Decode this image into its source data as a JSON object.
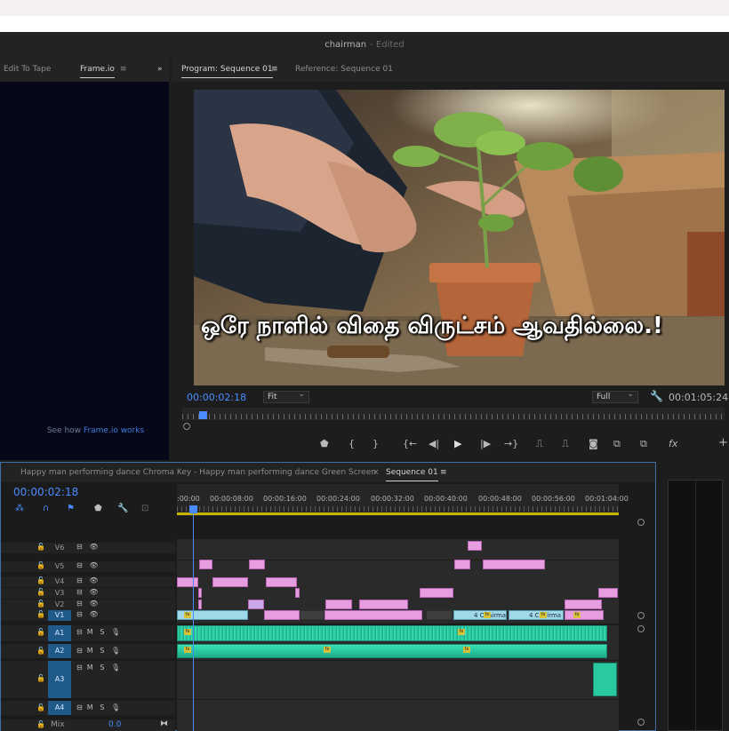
{
  "window": {
    "title": "chairman",
    "status": "- Edited"
  },
  "left_panel": {
    "tabs": [
      {
        "label": "Edit To Tape"
      },
      {
        "label": "Frame.io"
      }
    ],
    "menu_glyph": "≡",
    "overflow_glyph": "»",
    "footer_prefix": "See how ",
    "footer_link": "Frame.io works"
  },
  "program_monitor": {
    "tabs": [
      {
        "label": "Program: Sequence 01"
      },
      {
        "label": "Reference: Sequence 01"
      }
    ],
    "subtitle": "ஒரே நாளில் விதை விருட்சம் ஆவதில்லை.!",
    "timecode": "00:00:02:18",
    "fit_value": "Fit",
    "resolution_value": "Full",
    "duration": "00:01:05:24",
    "controls": [
      "marker-icon",
      "mark-in-icon",
      "mark-out-icon",
      "go-to-in-icon",
      "step-back-icon",
      "play-icon",
      "step-forward-icon",
      "go-to-out-icon",
      "lift-icon",
      "extract-icon",
      "export-frame-icon",
      "insert-icon",
      "overwrite-icon",
      "fx-icon",
      "add-icon"
    ]
  },
  "timeline": {
    "tabs": [
      {
        "label": "Happy man performing dance Chroma Key - Happy man performing dance Green Screen"
      },
      {
        "label": "Sequence 01"
      }
    ],
    "close_glyph": "×",
    "timecode": "00:00:02:18",
    "ruler_labels": [
      ":00:00",
      "00:00:08:00",
      "00:00:16:00",
      "00:00:24:00",
      "00:00:32:00",
      "00:00:40:00",
      "00:00:48:00",
      "00:00:56:00",
      "00:01:04:00"
    ],
    "video_tracks": [
      "V6",
      "V5",
      "V4",
      "V3",
      "V2",
      "V1"
    ],
    "audio_tracks": [
      "A1",
      "A2",
      "A3",
      "A4"
    ],
    "audio_buttons": {
      "mute": "M",
      "solo": "S"
    },
    "mix_label": "Mix",
    "mix_value": "0.0",
    "clip_label": "4 Chairma",
    "fx_label": "fx"
  },
  "colors": {
    "accent": "#4a8cff",
    "video_clip": "#e79ee0",
    "source_clip": "#9fd8e8",
    "audio_clip": "#29c9a2",
    "work_area": "#c8b400"
  }
}
